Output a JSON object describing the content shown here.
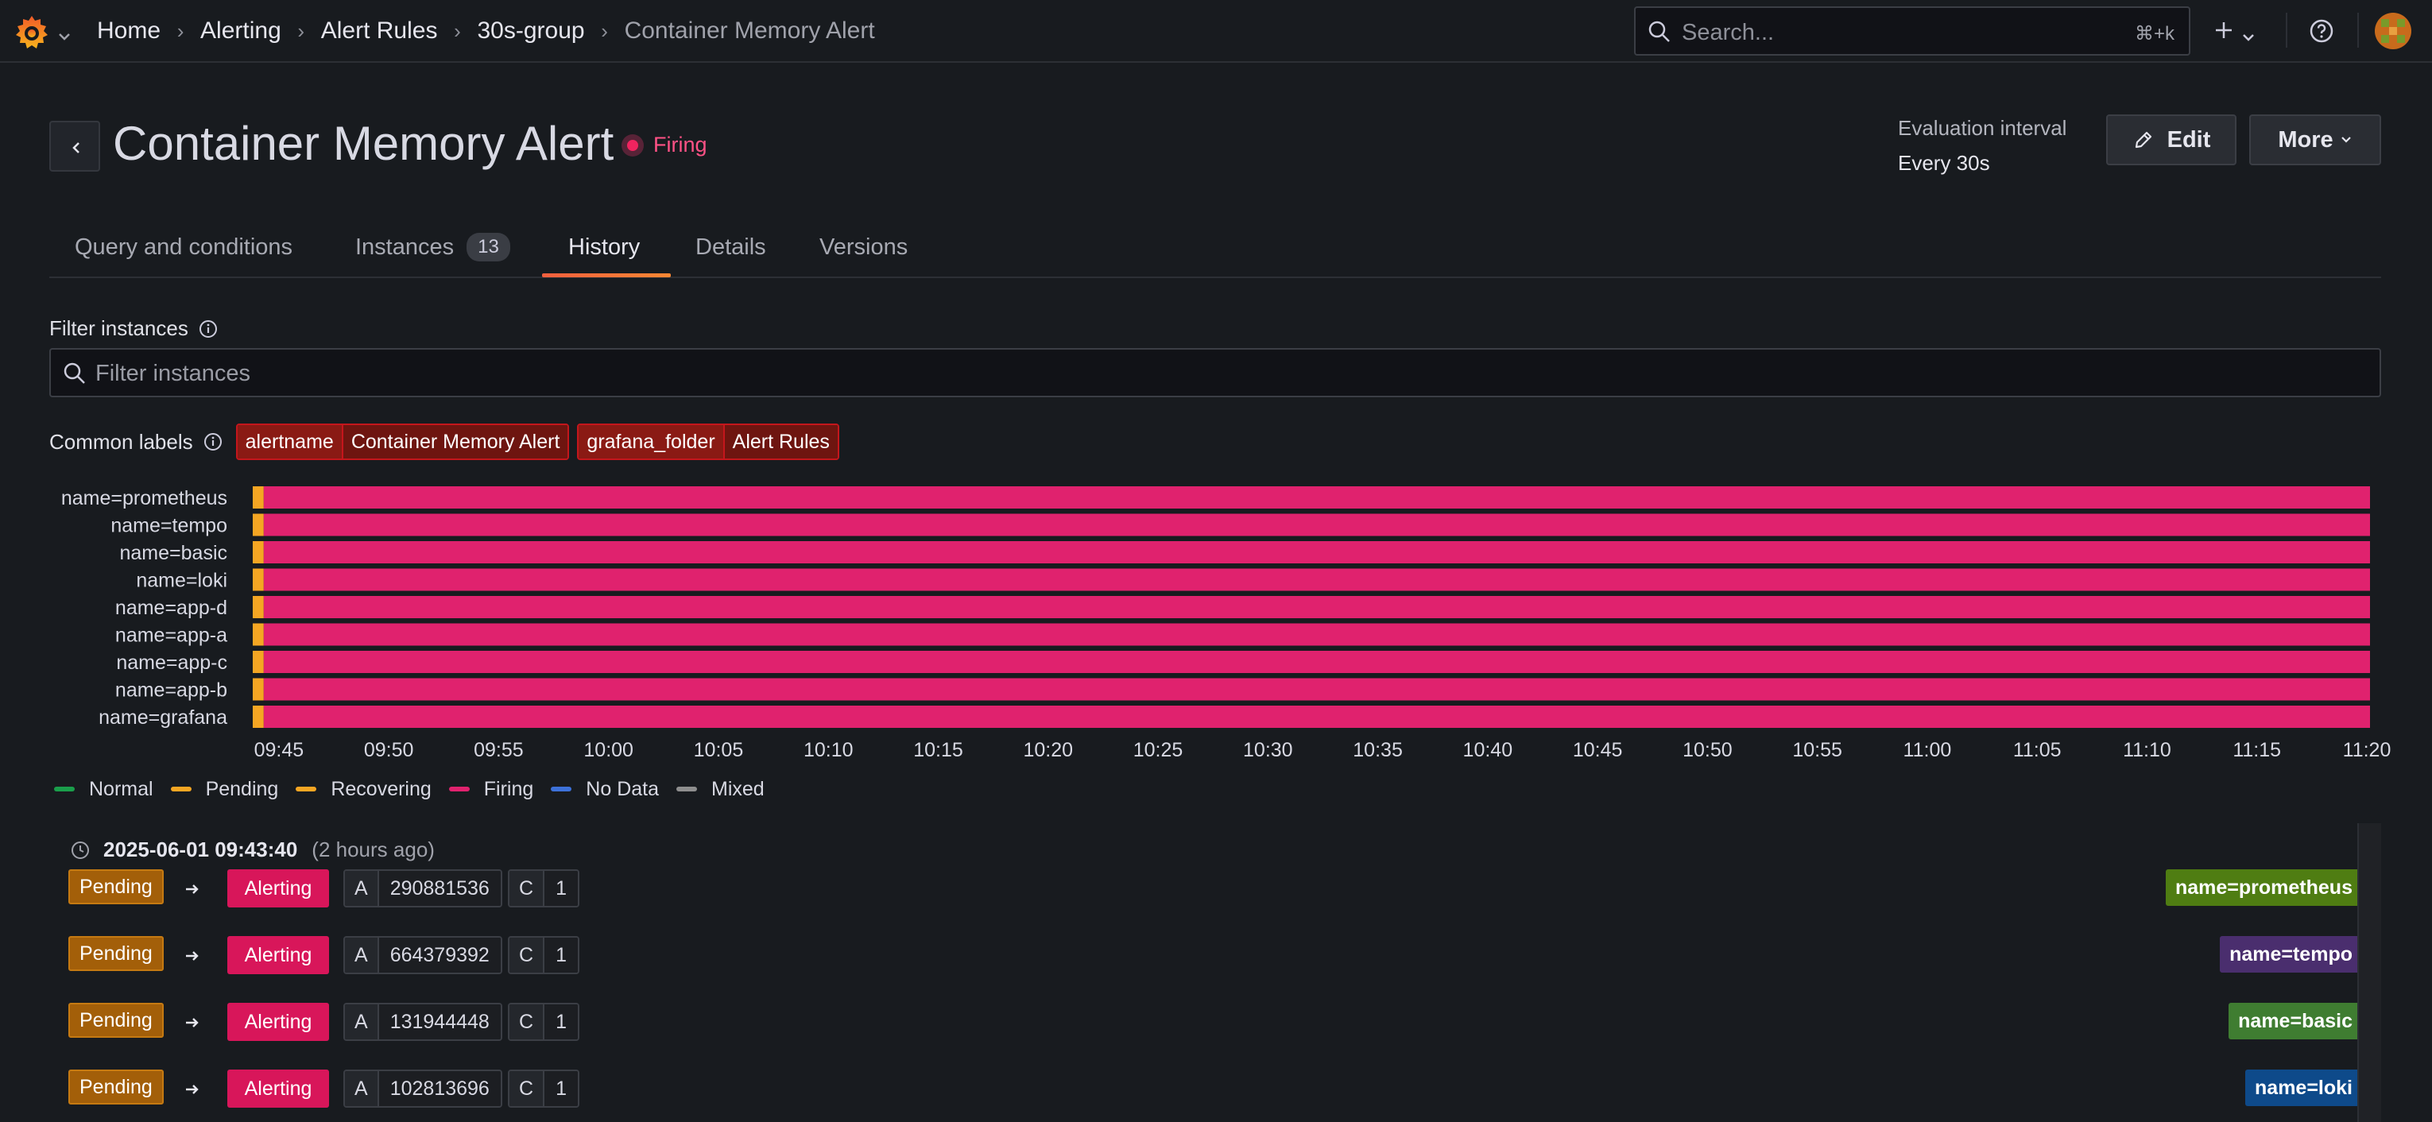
{
  "breadcrumb": [
    "Home",
    "Alerting",
    "Alert Rules",
    "30s-group",
    "Container Memory Alert"
  ],
  "search": {
    "placeholder": "Search...",
    "shortcut": "⌘+k"
  },
  "header": {
    "title": "Container Memory Alert",
    "state": "Firing",
    "eval_label": "Evaluation interval",
    "eval_value": "Every 30s",
    "edit_label": "Edit",
    "more_label": "More"
  },
  "tabs": [
    {
      "label": "Query and conditions"
    },
    {
      "label": "Instances",
      "count": "13"
    },
    {
      "label": "History",
      "active": true
    },
    {
      "label": "Details"
    },
    {
      "label": "Versions"
    }
  ],
  "filter": {
    "label": "Filter instances",
    "placeholder": "Filter instances"
  },
  "common_labels": {
    "title": "Common labels",
    "labels": [
      {
        "key": "alertname",
        "value": "Container Memory Alert"
      },
      {
        "key": "grafana_folder",
        "value": "Alert Rules"
      }
    ]
  },
  "chart_data": {
    "type": "timeline",
    "rows": [
      "name=prometheus",
      "name=tempo",
      "name=basic",
      "name=loki",
      "name=app-d",
      "name=app-a",
      "name=app-c",
      "name=app-b",
      "name=grafana"
    ],
    "x_ticks": [
      "09:45",
      "09:50",
      "09:55",
      "10:00",
      "10:05",
      "10:10",
      "10:15",
      "10:20",
      "10:25",
      "10:30",
      "10:35",
      "10:40",
      "10:45",
      "10:50",
      "10:55",
      "11:00",
      "11:05",
      "11:10",
      "11:15",
      "11:20"
    ],
    "x_range": [
      "09:43:40",
      "11:20"
    ],
    "segments": [
      {
        "state": "Pending",
        "from": "09:43:40",
        "to": "09:44:10"
      },
      {
        "state": "Firing",
        "from": "09:44:10",
        "to": "11:20"
      }
    ]
  },
  "legend": [
    {
      "label": "Normal",
      "color": "#1a9e4b"
    },
    {
      "label": "Pending",
      "color": "#f5a623"
    },
    {
      "label": "Recovering",
      "color": "#f5a623"
    },
    {
      "label": "Firing",
      "color": "#e0226e"
    },
    {
      "label": "No Data",
      "color": "#3d71d9"
    },
    {
      "label": "Mixed",
      "color": "#8e8e8e"
    }
  ],
  "history": {
    "timestamp": "2025-06-01 09:43:40",
    "ago": "(2 hours ago)",
    "rows": [
      {
        "from": "Pending",
        "to": "Alerting",
        "a_key": "A",
        "a_value": "290881536",
        "c_key": "C",
        "c_value": "1",
        "instance": "name=prometheus",
        "color": "#4f7d12"
      },
      {
        "from": "Pending",
        "to": "Alerting",
        "a_key": "A",
        "a_value": "664379392",
        "c_key": "C",
        "c_value": "1",
        "instance": "name=tempo",
        "color": "#4a2e6e"
      },
      {
        "from": "Pending",
        "to": "Alerting",
        "a_key": "A",
        "a_value": "131944448",
        "c_key": "C",
        "c_value": "1",
        "instance": "name=basic",
        "color": "#3f7d31"
      },
      {
        "from": "Pending",
        "to": "Alerting",
        "a_key": "A",
        "a_value": "102813696",
        "c_key": "C",
        "c_value": "1",
        "instance": "name=loki",
        "color": "#0e4a8a"
      }
    ]
  }
}
